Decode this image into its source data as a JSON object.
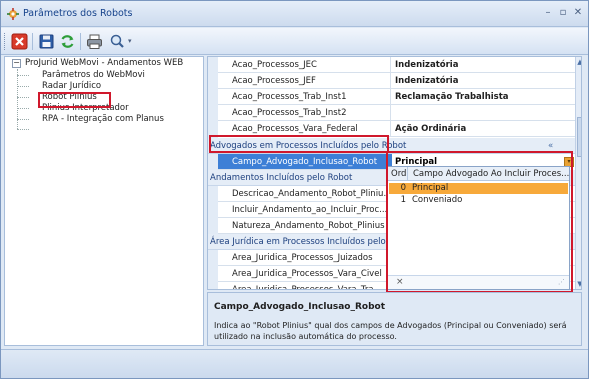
{
  "window": {
    "title": "Parâmetros dos Robots"
  },
  "tree": {
    "root": "ProJurid WebMovi - Andamentos WEB",
    "items": [
      "Parâmetros do WebMovi",
      "Radar Jurídico",
      "Robot Plinius",
      "Plinius Interpretador",
      "RPA - Integração com Planus"
    ],
    "selected": "Robot Plinius"
  },
  "grid": {
    "rows": [
      {
        "name": "Acao_Processos_JEC",
        "value": "Indenizatória"
      },
      {
        "name": "Acao_Processos_JEF",
        "value": "Indenizatória"
      },
      {
        "name": "Acao_Processos_Trab_Inst1",
        "value": "Reclamação Trabalhista"
      },
      {
        "name": "Acao_Processos_Trab_Inst2",
        "value": ""
      },
      {
        "name": "Acao_Processos_Vara_Federal",
        "value": "Ação Ordinária"
      }
    ],
    "category_advogados": "Advogados em Processos Incluídos pelo Robot",
    "campo_advogado": {
      "name": "Campo_Advogado_Inclusao_Robot",
      "value": "Principal"
    },
    "category_andamentos": "Andamentos Incluídos pelo Robot",
    "andamentos_rows": [
      "Descricao_Andamento_Robot_Pliniu...",
      "Incluir_Andamento_ao_Incluir_Proc...",
      "Natureza_Andamento_Robot_Plinius"
    ],
    "category_area": "Área Jurídica em Processos Incluídos pelo Robot",
    "area_rows": [
      "Area_Juridica_Processos_Juizados",
      "Area_Juridica_Processos_Vara_Civel",
      "Area_Juridica_Processos_Vara_Tra..."
    ]
  },
  "dropdown": {
    "header_ord": "Ord",
    "header_campo": "Campo Advogado Ao Incluir Proces...",
    "options": [
      {
        "ord": "0",
        "label": "Principal"
      },
      {
        "ord": "1",
        "label": "Conveniado"
      }
    ],
    "close_glyph": "×"
  },
  "help": {
    "title": "Campo_Advogado_Inclusao_Robot",
    "text": "Indica ao \"Robot Plinius\" qual dos campos de Advogados (Principal ou Conveniado) será utilizado na inclusão automática do processo."
  },
  "colors": {
    "accent": "#15428b",
    "highlight": "#f7a93a",
    "annotation": "#d0182c",
    "category_bg": "#e5edf7"
  }
}
